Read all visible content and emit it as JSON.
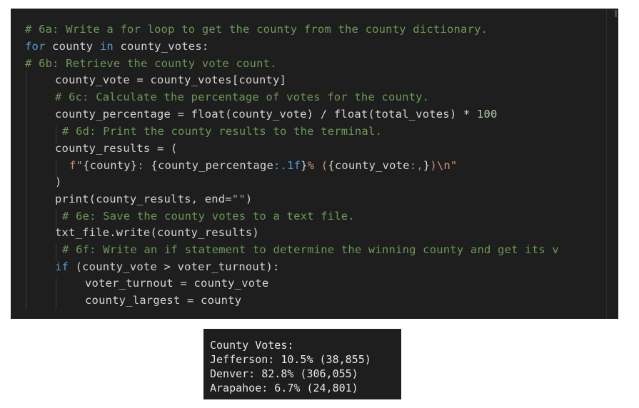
{
  "colors": {
    "background": "#1e1e1e",
    "comment": "#6a9955",
    "keyword": "#569cd6",
    "text": "#d4d4d4",
    "string": "#ce9178",
    "number": "#b5cea8"
  },
  "code": {
    "lines": [
      {
        "comment": "# 6a: Write a for loop to get the county from the county dictionary."
      },
      {
        "kw1": "for",
        "t1": " county ",
        "kw2": "in",
        "t2": " county_votes:"
      },
      {
        "comment": "# 6b: Retrieve the county vote count."
      },
      {
        "text": "county_vote = county_votes[county]"
      },
      {
        "comment": "# 6c: Calculate the percentage of votes for the county."
      },
      {
        "t1": "county_percentage = float(county_vote) / float(total_votes) * ",
        "num": "100"
      },
      {
        "comment": "# 6d: Print the county results to the terminal."
      },
      {
        "text": "county_results = ("
      },
      {
        "s1": "f\"",
        "t1": "{county}",
        "s2": ": ",
        "t2": "{county_percentage",
        "s3": ":.1f",
        "t3": "}",
        "s4": "% (",
        "t4": "{county_vote",
        "s5": ":,",
        "t5": "}",
        "s6": ")\\n\""
      },
      {
        "text": ")"
      },
      {
        "t1": "print(county_results, end=",
        "str": "\"\"",
        "t2": ")"
      },
      {
        "comment": "# 6e: Save the county votes to a text file."
      },
      {
        "text": "txt_file.write(county_results)"
      },
      {
        "comment": "# 6f: Write an if statement to determine the winning county and get its v"
      },
      {
        "kw": "if",
        "t1": " (county_vote > voter_turnout):"
      },
      {
        "text": "voter_turnout = county_vote"
      },
      {
        "text": "county_largest = county"
      }
    ]
  },
  "terminal": {
    "lines": [
      "County Votes:",
      "Jefferson: 10.5% (38,855)",
      "Denver: 82.8% (306,055)",
      "Arapahoe: 6.7% (24,801)"
    ]
  }
}
